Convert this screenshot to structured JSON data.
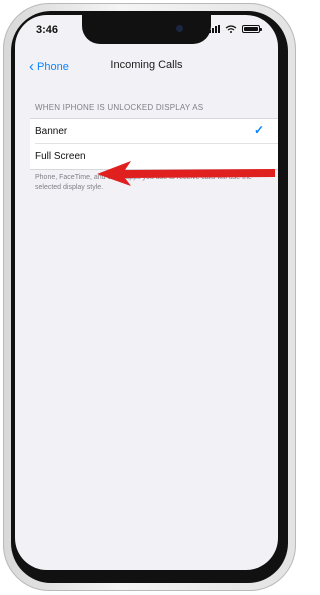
{
  "status_bar": {
    "time": "3:46"
  },
  "nav": {
    "back_label": "Phone",
    "title": "Incoming Calls"
  },
  "section": {
    "header": "WHEN IPHONE IS UNLOCKED DISPLAY AS",
    "options": [
      {
        "label": "Banner",
        "selected": true
      },
      {
        "label": "Full Screen",
        "selected": false
      }
    ],
    "footer": "Phone, FaceTime, and other apps you use to receive calls will use the selected display style."
  },
  "colors": {
    "accent": "#0a84ff",
    "arrow": "#e01f1f",
    "background": "#f2f2f6"
  }
}
